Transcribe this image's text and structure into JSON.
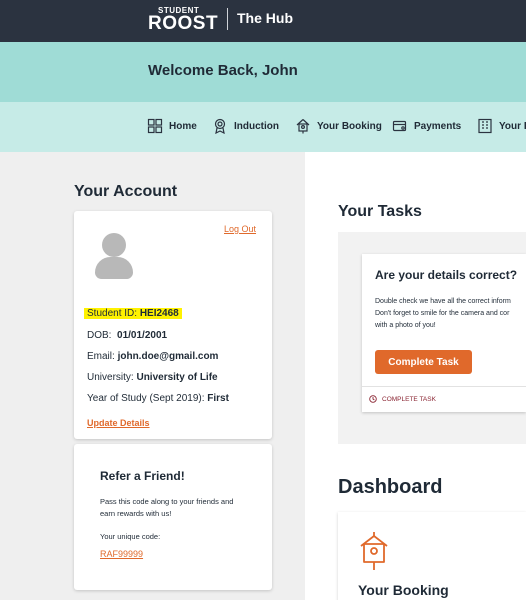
{
  "header": {
    "logo_small": "STUDENT",
    "logo_big": "ROOST",
    "hub_title": "The Hub"
  },
  "welcome": {
    "text": "Welcome Back, John"
  },
  "nav": {
    "items": [
      {
        "label": "Home",
        "icon": "home-grid-icon"
      },
      {
        "label": "Induction",
        "icon": "badge-icon"
      },
      {
        "label": "Your Booking",
        "icon": "birdhouse-icon"
      },
      {
        "label": "Payments",
        "icon": "payment-icon"
      },
      {
        "label": "Your R",
        "icon": "building-icon"
      }
    ]
  },
  "account": {
    "section_title": "Your Account",
    "logout": "Log Out",
    "student_id_label": "Student ID:",
    "student_id": "HEI2468",
    "dob_label": "DOB:",
    "dob": "01/01/2001",
    "email_label": "Email:",
    "email": "john.doe@gmail.com",
    "university_label": "University:",
    "university": "University of Life",
    "year_label": "Year of Study (Sept 2019):",
    "year": "First",
    "update": "Update Details"
  },
  "refer": {
    "title": "Refer a Friend!",
    "text": "Pass this code along to your friends and earn rewards with us!",
    "code_label": "Your unique code:",
    "code": "RAF99999"
  },
  "tasks": {
    "section_title": "Your Tasks",
    "card_title": "Are your details correct?",
    "line1": "Double check we have all the correct inform",
    "line2": "Don't forget to smile for the camera and cor",
    "line3": "with a photo of you!",
    "button": "Complete Task",
    "status": "COMPLETE TASK"
  },
  "dashboard": {
    "title": "Dashboard",
    "card_label": "Your Booking"
  },
  "colors": {
    "topbar": "#2b3340",
    "welcome_bg": "#9fdcd6",
    "nav_bg": "#c6ebe7",
    "accent": "#e0692b",
    "highlight": "#fff200"
  }
}
